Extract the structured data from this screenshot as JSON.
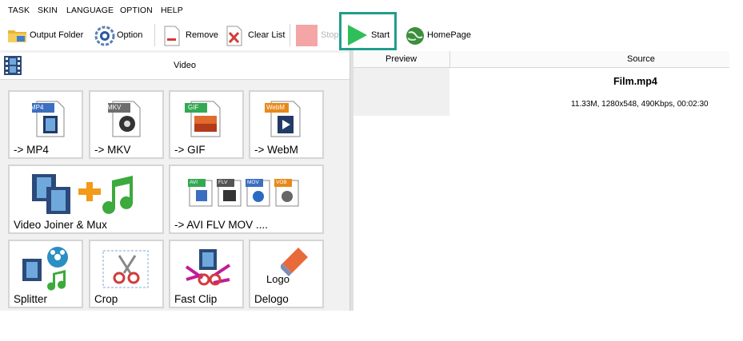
{
  "menu": [
    "TASK",
    "SKIN",
    "LANGUAGE",
    "OPTION",
    "HELP"
  ],
  "toolbar": {
    "output_folder": "Output Folder",
    "option": "Option",
    "remove": "Remove",
    "clear_list": "Clear List",
    "stop": "Stop",
    "start": "Start",
    "homepage": "HomePage"
  },
  "left_panel": {
    "header": "Video",
    "tiles": [
      {
        "label": "-> MP4",
        "badge": "MP4",
        "badge_color": "#3b6fc1"
      },
      {
        "label": "-> MKV",
        "badge": "MKV",
        "badge_color": "#6e6e6e"
      },
      {
        "label": "-> GIF",
        "badge": "GIF",
        "badge_color": "#34a853"
      },
      {
        "label": "-> WebM",
        "badge": "WebM",
        "badge_color": "#e8891a"
      },
      {
        "label": "Video Joiner & Mux"
      },
      {
        "label": "-> AVI FLV MOV ....",
        "badges": [
          "AVI",
          "FLV",
          "MOV",
          "VOB"
        ]
      },
      {
        "label": "Splitter"
      },
      {
        "label": "Crop"
      },
      {
        "label": "Fast Clip"
      },
      {
        "label": "Delogo",
        "logo_text": "Logo"
      }
    ]
  },
  "file_list": {
    "columns": [
      "Preview",
      "Source"
    ],
    "rows": [
      {
        "name": "Film.mp4",
        "info": "11.33M, 1280x548, 490Kbps, 00:02:30"
      }
    ]
  },
  "colors": {
    "accent": "#1f9e8c",
    "start_green": "#2fbf5a",
    "stop_red": "#f4a5a5"
  }
}
